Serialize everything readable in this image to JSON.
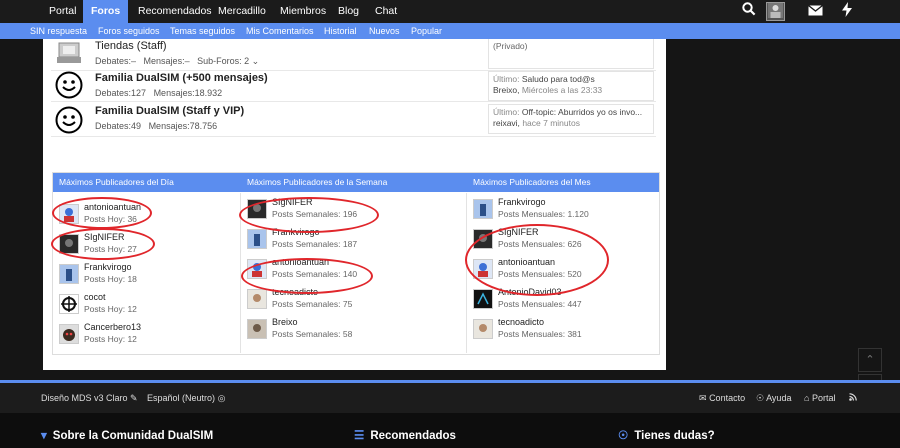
{
  "topnav": {
    "items": [
      "Portal",
      "Foros",
      "Recomendados",
      "Mercadillo",
      "Miembros",
      "Blog",
      "Chat"
    ],
    "active": "Foros",
    "icons": [
      "search-icon",
      "user-avatar-icon",
      "envelope-icon",
      "bolt-icon"
    ]
  },
  "subnav": {
    "items": [
      "SIN respuesta",
      "Foros seguidos",
      "Temas seguidos",
      "Mis Comentarios",
      "Historial",
      "Nuevos",
      "Popular"
    ]
  },
  "forums": [
    {
      "title": "Tiendas (Staff)",
      "debates": "Debates:–",
      "mensajes": "Mensajes:–",
      "subforos": "Sub-Foros: 2",
      "last_line1": "(Privado)",
      "last_line2": ""
    },
    {
      "title": "Familia DualSIM (+500 mensajes)",
      "debates": "Debates:127",
      "mensajes": "Mensajes:18.932",
      "last_label": "Último:",
      "last_line1": "Saludo para tod@s",
      "last_user": "Breixo,",
      "last_time": "Miércoles a las 23:33"
    },
    {
      "title": "Familia DualSIM (Staff y VIP)",
      "debates": "Debates:49",
      "mensajes": "Mensajes:78.756",
      "last_label": "Último:",
      "last_line1": "Off-topic: Aburridos yo os invo...",
      "last_user": "reixavi,",
      "last_time": "hace 7 minutos"
    }
  ],
  "top_posters": {
    "columns": [
      {
        "title": "Máximos Publicadores del Día",
        "entries": [
          {
            "name": "antonioantuan",
            "posts": "Posts Hoy: 36"
          },
          {
            "name": "SIgNIFER",
            "posts": "Posts Hoy: 27"
          },
          {
            "name": "Frankvirogo",
            "posts": "Posts Hoy: 18"
          },
          {
            "name": "cocot",
            "posts": "Posts Hoy: 12"
          },
          {
            "name": "Cancerbero13",
            "posts": "Posts Hoy: 12"
          }
        ]
      },
      {
        "title": "Máximos Publicadores de la Semana",
        "entries": [
          {
            "name": "SIgNIFER",
            "posts": "Posts Semanales: 196"
          },
          {
            "name": "Frankvirogo",
            "posts": "Posts Semanales: 187"
          },
          {
            "name": "antonioantuan",
            "posts": "Posts Semanales: 140"
          },
          {
            "name": "tecnoadicto",
            "posts": "Posts Semanales: 75"
          },
          {
            "name": "Breixo",
            "posts": "Posts Semanales: 58"
          }
        ]
      },
      {
        "title": "Máximos Publicadores del Mes",
        "entries": [
          {
            "name": "Frankvirogo",
            "posts": "Posts Mensuales: 1.120"
          },
          {
            "name": "SIgNIFER",
            "posts": "Posts Mensuales: 626"
          },
          {
            "name": "antonioantuan",
            "posts": "Posts Mensuales: 520"
          },
          {
            "name": "AntonioDavid03",
            "posts": "Posts Mensuales: 447"
          },
          {
            "name": "tecnoadicto",
            "posts": "Posts Mensuales: 381"
          }
        ]
      }
    ]
  },
  "footer": {
    "style": "Diseño MDS v3 Claro",
    "language": "Español (Neutro)",
    "links": [
      "Contacto",
      "Ayuda",
      "Portal"
    ]
  },
  "bottom": {
    "headings": [
      "Sobre la Comunidad DualSIM",
      "Recomendados",
      "Tienes dudas?"
    ]
  },
  "colors": {
    "accent": "#5b8def",
    "topbar": "#1b1b1b",
    "annotation": "#e0262b"
  }
}
